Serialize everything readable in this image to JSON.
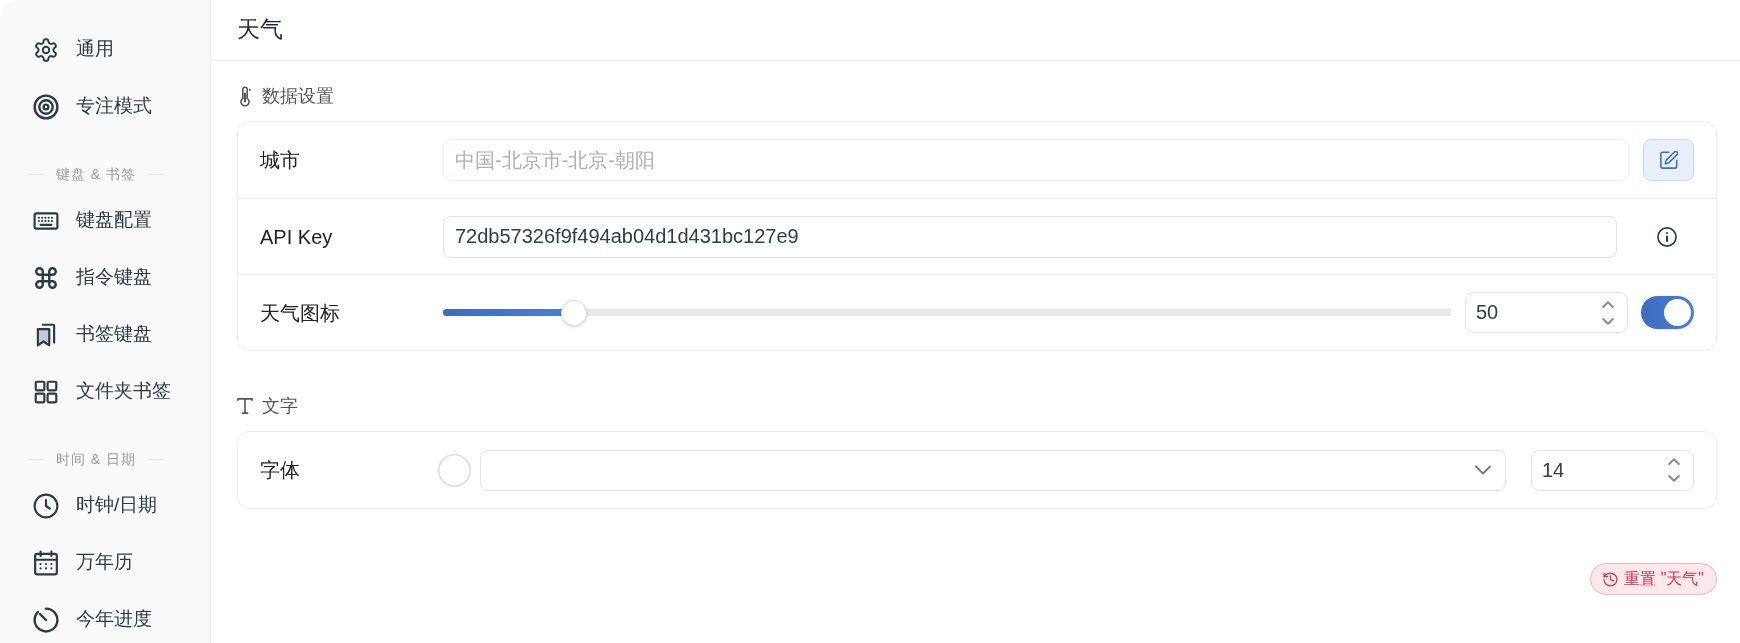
{
  "sidebar": {
    "groups": [
      {
        "items": [
          {
            "label": "通用",
            "selected": false
          },
          {
            "label": "专注模式",
            "selected": false
          }
        ]
      },
      {
        "heading": "键盘 & 书签",
        "items": [
          {
            "label": "键盘配置",
            "selected": false
          },
          {
            "label": "指令键盘",
            "selected": false
          },
          {
            "label": "书签键盘",
            "selected": false
          },
          {
            "label": "文件夹书签",
            "selected": false
          }
        ]
      },
      {
        "heading": "时间 & 日期",
        "items": [
          {
            "label": "时钟/日期",
            "selected": false
          },
          {
            "label": "万年历",
            "selected": false
          },
          {
            "label": "今年进度",
            "selected": false
          }
        ]
      }
    ]
  },
  "page": {
    "title": "天气"
  },
  "sections": [
    {
      "title": "数据设置",
      "rows": [
        {
          "kind": "location",
          "label": "城市",
          "value": "中国-北京市-北京-朝阳",
          "disabled": true
        },
        {
          "kind": "text",
          "label": "API Key",
          "value": "72db57326f9f494ab04d1d431bc127e9",
          "disabled": false
        },
        {
          "kind": "slider",
          "label": "天气图标",
          "level": 0.12,
          "value": "50",
          "on": true
        }
      ]
    },
    {
      "title": "文字",
      "rows": [
        {
          "kind": "font",
          "label": "字体",
          "value": "14"
        }
      ]
    }
  ],
  "reset_button": {
    "label": "重置 \"天气\""
  }
}
